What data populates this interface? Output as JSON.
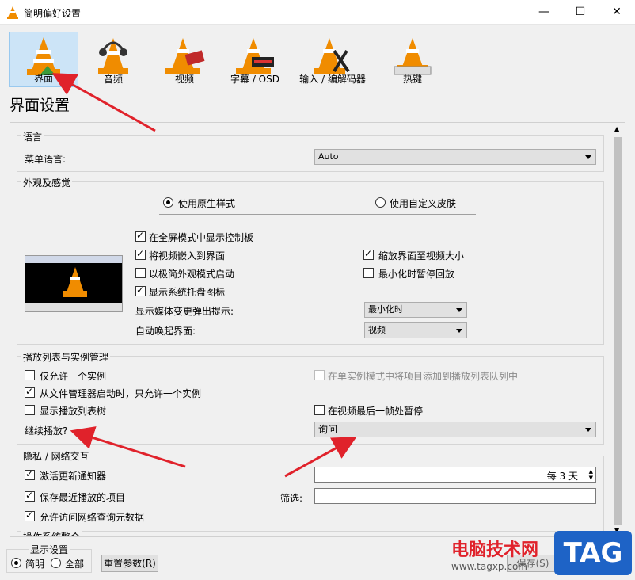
{
  "window": {
    "title": "简明偏好设置",
    "minimize": "—",
    "maximize": "☐",
    "close": "✕"
  },
  "toolbar": {
    "items": [
      {
        "label": "界面",
        "selected": true
      },
      {
        "label": "音频"
      },
      {
        "label": "视频"
      },
      {
        "label": "字幕 / OSD"
      },
      {
        "label": "输入 / 编解码器"
      },
      {
        "label": "热键"
      }
    ]
  },
  "section": {
    "title": "界面设置"
  },
  "language": {
    "group_label": "语言",
    "menu_language_label": "菜单语言:",
    "menu_language_value": "Auto"
  },
  "appearance": {
    "group_label": "外观及感觉",
    "radio_native": "使用原生样式",
    "radio_custom": "使用自定义皮肤",
    "cb_fullscreen_controller": "在全屏模式中显示控制板",
    "cb_embed_video": "将视频嵌入到界面",
    "cb_minimal": "以极简外观模式启动",
    "cb_systray": "显示系统托盘图标",
    "cb_resize_to_video": "缩放界面至视频大小",
    "cb_pause_minimized": "最小化时暂停回放",
    "popup_label": "显示媒体变更弹出提示:",
    "popup_value": "最小化时",
    "raise_label": "自动唤起界面:",
    "raise_value": "视频"
  },
  "playlist": {
    "group_label": "播放列表与实例管理",
    "cb_one_instance": "仅允许一个实例",
    "cb_enqueue": "在单实例模式中将项目添加到播放列表队列中",
    "cb_one_instance_file": "从文件管理器启动时，只允许一个实例",
    "cb_show_tree": "显示播放列表树",
    "cb_pause_last_frame": "在视频最后一帧处暂停",
    "continue_label": "继续播放?",
    "continue_value": "询问"
  },
  "privacy": {
    "group_label": "隐私 / 网络交互",
    "cb_update_notifier": "激活更新通知器",
    "update_value": "每 3 天",
    "cb_recent": "保存最近播放的项目",
    "filter_label": "筛选:",
    "cb_metadata": "允许访问网络查询元数据",
    "partial_next_group": "操作系统整合"
  },
  "bottom": {
    "show_settings_label": "显示设置",
    "radio_simple": "简明",
    "radio_all": "全部",
    "reset_button": "重置参数(R)",
    "save_button": "保存(S)"
  },
  "watermark": {
    "site_name": "电脑技术网",
    "url": "www.tagxp.com",
    "badge": "TAG"
  },
  "colors": {
    "accent_selected": "#cce4f7",
    "arrow": "#e0222b",
    "vlc_orange": "#f08c00"
  }
}
